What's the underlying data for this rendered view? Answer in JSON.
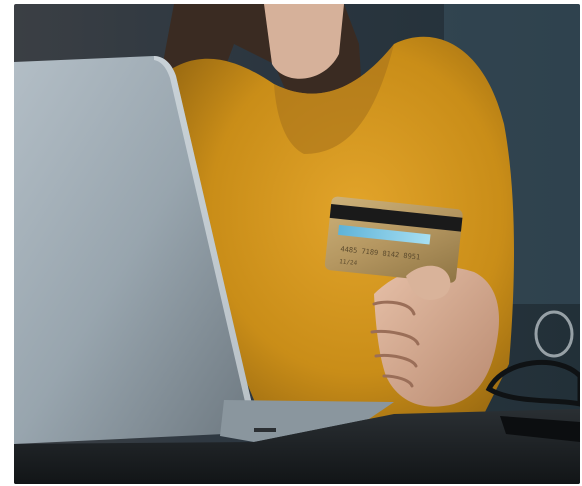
{
  "photo": {
    "subject": "person-holding-credit-card-at-laptop",
    "card": {
      "visible_number": "4485 7189 8142 8951",
      "visible_expiry": "11/24"
    },
    "colors": {
      "background": "#2a3a44",
      "sweater": "#d0951c",
      "laptop": "#9aa7b0",
      "table": "#1b1f22",
      "card_gold": "#b79a62",
      "card_stripe": "#1a1a1a",
      "signature_strip": "#7ec9e8"
    }
  }
}
